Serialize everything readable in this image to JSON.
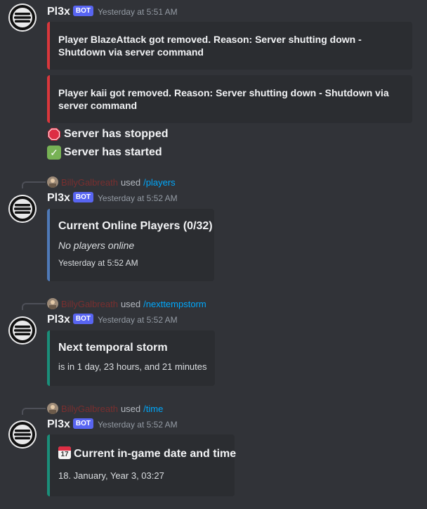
{
  "bot": {
    "name": "Pl3x",
    "tag": "BOT"
  },
  "messages": [
    {
      "timestamp": "Yesterday at 5:51 AM",
      "embeds": [
        "Player BlazeAttack got removed. Reason: Server shutting down - Shutdown via server command",
        "Player kaii got removed. Reason: Server shutting down - Shutdown via server command"
      ],
      "status_lines": [
        {
          "icon": "stop-sign-icon",
          "text": "Server has stopped"
        },
        {
          "icon": "check-mark-icon",
          "text": "Server has started"
        }
      ]
    },
    {
      "reply": {
        "user": "BillyGalbreath",
        "used": "used",
        "command": "/players"
      },
      "timestamp": "Yesterday at 5:52 AM",
      "embed": {
        "title": "Current Online Players (0/32)",
        "description": "No players online",
        "footer": "Yesterday at 5:52 AM"
      }
    },
    {
      "reply": {
        "user": "BillyGalbreath",
        "used": "used",
        "command": "/nexttempstorm"
      },
      "timestamp": "Yesterday at 5:52 AM",
      "embed": {
        "title": "Next temporal storm",
        "description": "is in 1 day, 23 hours, and 21 minutes"
      }
    },
    {
      "reply": {
        "user": "BillyGalbreath",
        "used": "used",
        "command": "/time"
      },
      "timestamp": "Yesterday at 5:52 AM",
      "embed": {
        "title_icon": "calendar-icon",
        "calendar_label": "17",
        "title": "Current in-game date and time",
        "description": "18. January, Year 3, 03:27"
      }
    }
  ],
  "colors": {
    "background": "#313338",
    "embed_background": "#2b2d31",
    "red_border": "#da373c",
    "blue_border": "#4f7ab8",
    "teal_border": "#1a8f7a",
    "bot_tag": "#5865f2",
    "command_link": "#00a8fc"
  }
}
